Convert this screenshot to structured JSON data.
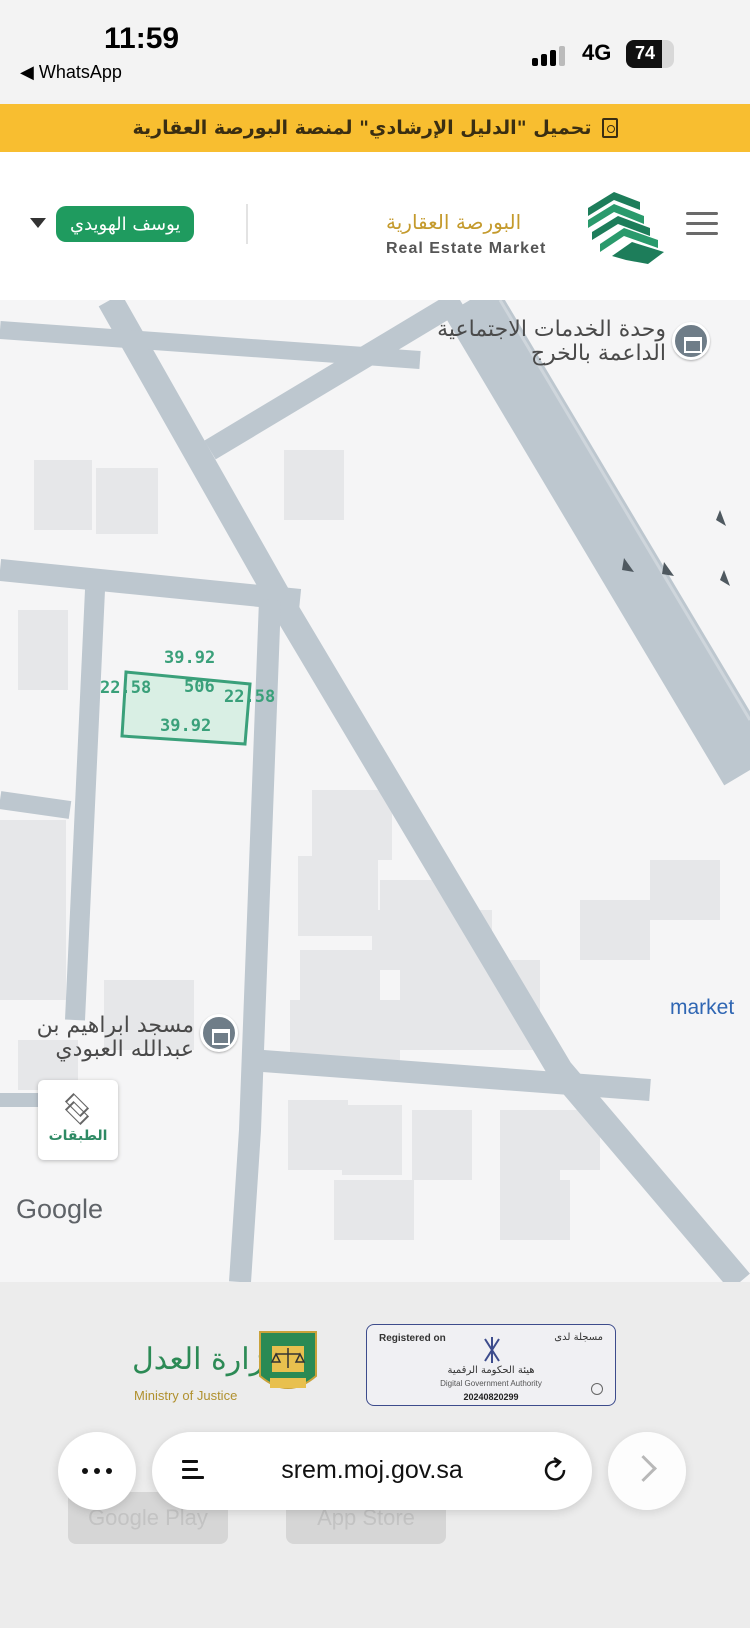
{
  "status_bar": {
    "time": "11:59",
    "back_app": "◀ WhatsApp",
    "network": "4G",
    "battery_percent": "74",
    "battery_level": 0.74
  },
  "banner": {
    "text": "تحميل \"الدليل الإرشادي\" لمنصة البورصة العقارية",
    "icon": "pdf-icon"
  },
  "header": {
    "user_name": "يوسف الهويدي",
    "brand_ar": "البورصة العقارية",
    "brand_en": "Real Estate Market",
    "menu_icon": "hamburger-menu-icon",
    "colors": {
      "user_badge": "#1f9b5f",
      "brand_gold": "#c49a2c",
      "logo_green": "#1d7d5a"
    }
  },
  "map": {
    "poi_social_services": "وحدة الخدمات الاجتماعية\nالداعمة بالخرج",
    "poi_mosque": "مسجد ابراهيم بن\nعبدالله العبودي",
    "market_label": "market",
    "plot": {
      "number": "506",
      "top_side": "39.92",
      "bottom_side": "39.92",
      "left_side": "22.58",
      "right_side": "22.58",
      "color": "#3aa07a"
    },
    "layers_button": "الطبقات",
    "attribution": "Google"
  },
  "footer": {
    "moj_ar": "وزارة العدل",
    "moj_en": "Ministry of Justice",
    "dga_registered_en": "Registered on",
    "dga_registered_ar": "مسجلة لدى",
    "dga_name_ar": "هيئة الحكومة الرقمية",
    "dga_name_en": "Digital Government Authority",
    "dga_id": "20240820299",
    "store_google": "Google Play",
    "store_apple": "App Store"
  },
  "browser": {
    "url": "srem.moj.gov.sa",
    "more_icon": "more-dots-icon",
    "reader_icon": "reader-mode-icon",
    "reload_icon": "reload-icon",
    "forward_icon": "chevron-right-icon"
  }
}
